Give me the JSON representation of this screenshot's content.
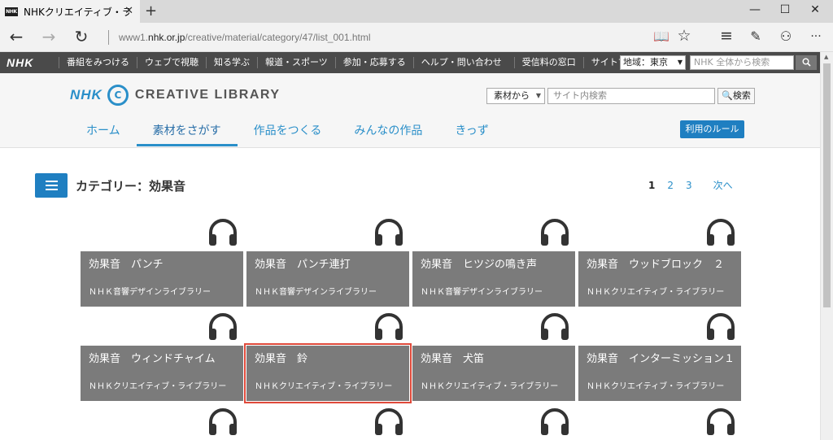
{
  "browser": {
    "tab_title": "NHKクリエイティブ・ライブラ",
    "favicon_text": "NHK",
    "tab_close": "✕",
    "new_tab": "+",
    "url_prefix": "www1.",
    "url_domain": "nhk.or.jp",
    "url_path": "/creative/material/category/47/list_001.html",
    "win_min": "—",
    "win_max": "☐",
    "win_close": "✕",
    "back": "←",
    "forward": "→",
    "reload": "↻",
    "reading_view": "📖",
    "favorite": "☆",
    "hub": "≡",
    "note": "✎",
    "share": "⚇",
    "more": "···"
  },
  "global_bar": {
    "logo": "NHK",
    "links": [
      "番組をみつける",
      "ウェブで視聴",
      "知る学ぶ",
      "報道・スポーツ",
      "参加・応募する",
      "ヘルプ・問い合わせ",
      "受信料の窓口",
      "サイトマップ"
    ],
    "region": "地域：東京",
    "search_placeholder": "NHK 全体から検索",
    "search_icon": "🔍"
  },
  "header": {
    "brand_nhk": "NHK",
    "brand_c": "C",
    "brand_text": "CREATIVE LIBRARY",
    "site_select": "素材から",
    "site_search_placeholder": "サイト内検索",
    "site_search_button": "🔍検索",
    "nav": [
      "ホーム",
      "素材をさがす",
      "作品をつくる",
      "みんなの作品",
      "きっず"
    ],
    "rules_button": "利用のルール"
  },
  "content": {
    "category_title": "カテゴリー：効果音",
    "pager": [
      "1",
      "2",
      "3",
      "次へ"
    ],
    "cards": [
      {
        "title": "効果音　パンチ",
        "sub": "ＮＨＫ音響デザインライブラリー"
      },
      {
        "title": "効果音　パンチ連打",
        "sub": "ＮＨＫ音響デザインライブラリー"
      },
      {
        "title": "効果音　ヒツジの鳴き声",
        "sub": "ＮＨＫ音響デザインライブラリー"
      },
      {
        "title": "効果音　ウッドブロック　２",
        "sub": "ＮＨＫクリエイティブ・ライブラリー"
      },
      {
        "title": "効果音　ウィンドチャイム",
        "sub": "ＮＨＫクリエイティブ・ライブラリー"
      },
      {
        "title": "効果音　鈴",
        "sub": "ＮＨＫクリエイティブ・ライブラリー"
      },
      {
        "title": "効果音　犬笛",
        "sub": "ＮＨＫクリエイティブ・ライブラリー"
      },
      {
        "title": "効果音　インターミッション１",
        "sub": "ＮＨＫクリエイティブ・ライブラリー"
      }
    ]
  }
}
